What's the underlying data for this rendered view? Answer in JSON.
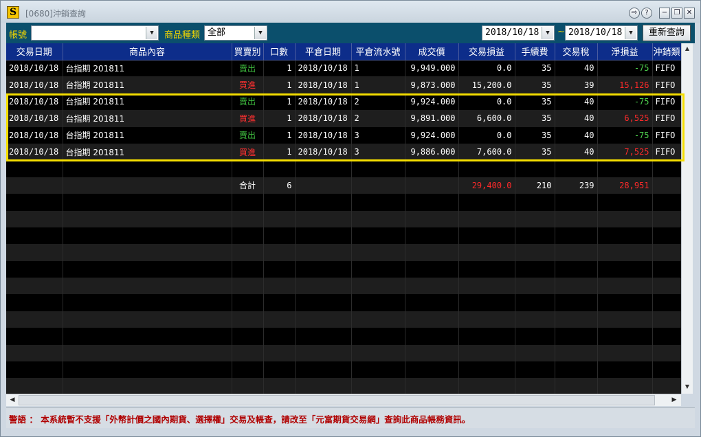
{
  "window": {
    "icon_glyph": "S",
    "title": "[0680]沖銷查詢",
    "buttons": {
      "dock": "⇨",
      "help": "?",
      "minimize": "−",
      "restore": "❐",
      "close": "✕"
    }
  },
  "filters": {
    "account_label": "帳號",
    "account_value": "",
    "product_type_label": "商品種類",
    "product_type_value": "全部",
    "date_from": "2018/10/18",
    "date_separator": "~",
    "date_to": "2018/10/18",
    "requery_label": "重新查詢"
  },
  "table": {
    "headers": [
      "交易日期",
      "商品內容",
      "買賣別",
      "口數",
      "平倉日期",
      "平倉流水號",
      "成交價",
      "交易損益",
      "手續費",
      "交易稅",
      "淨損益",
      "沖銷類"
    ],
    "rows": [
      {
        "date": "2018/10/18",
        "product": "台指期 201811",
        "side": "賣出",
        "side_type": "sell",
        "qty": "1",
        "close_date": "2018/10/18",
        "serial": "1",
        "price": "9,949.000",
        "pl": "0.0",
        "fee": "35",
        "tax": "40",
        "net": "-75",
        "net_sign": "neg",
        "method": "FIFO"
      },
      {
        "date": "2018/10/18",
        "product": "台指期 201811",
        "side": "買進",
        "side_type": "buy",
        "qty": "1",
        "close_date": "2018/10/18",
        "serial": "1",
        "price": "9,873.000",
        "pl": "15,200.0",
        "fee": "35",
        "tax": "39",
        "net": "15,126",
        "net_sign": "pos",
        "method": "FIFO"
      },
      {
        "date": "2018/10/18",
        "product": "台指期 201811",
        "side": "賣出",
        "side_type": "sell",
        "qty": "1",
        "close_date": "2018/10/18",
        "serial": "2",
        "price": "9,924.000",
        "pl": "0.0",
        "fee": "35",
        "tax": "40",
        "net": "-75",
        "net_sign": "neg",
        "method": "FIFO"
      },
      {
        "date": "2018/10/18",
        "product": "台指期 201811",
        "side": "買進",
        "side_type": "buy",
        "qty": "1",
        "close_date": "2018/10/18",
        "serial": "2",
        "price": "9,891.000",
        "pl": "6,600.0",
        "fee": "35",
        "tax": "40",
        "net": "6,525",
        "net_sign": "pos",
        "method": "FIFO"
      },
      {
        "date": "2018/10/18",
        "product": "台指期 201811",
        "side": "賣出",
        "side_type": "sell",
        "qty": "1",
        "close_date": "2018/10/18",
        "serial": "3",
        "price": "9,924.000",
        "pl": "0.0",
        "fee": "35",
        "tax": "40",
        "net": "-75",
        "net_sign": "neg",
        "method": "FIFO"
      },
      {
        "date": "2018/10/18",
        "product": "台指期 201811",
        "side": "買進",
        "side_type": "buy",
        "qty": "1",
        "close_date": "2018/10/18",
        "serial": "3",
        "price": "9,886.000",
        "pl": "7,600.0",
        "fee": "35",
        "tax": "40",
        "net": "7,525",
        "net_sign": "pos",
        "method": "FIFO"
      }
    ],
    "blank_rows_before_total": 1,
    "total": {
      "label": "合計",
      "qty": "6",
      "pl": "29,400.0",
      "fee": "210",
      "tax": "239",
      "net": "28,951"
    },
    "blank_rows_after_total": 12
  },
  "warning": "警語 ： 本系統暫不支援「外幣計價之國內期貨、選擇權」交易及帳查，請改至「元富期貨交易網」查詢此商品帳務資訊。",
  "colors": {
    "header_bg": "#0d2d8a",
    "filter_bg": "#0b4f6c",
    "label_yellow": "#f2d600",
    "sell_green": "#3fbf3f",
    "buy_red": "#ff3030",
    "highlight_border": "#f5de00",
    "warning_red": "#b00000"
  }
}
